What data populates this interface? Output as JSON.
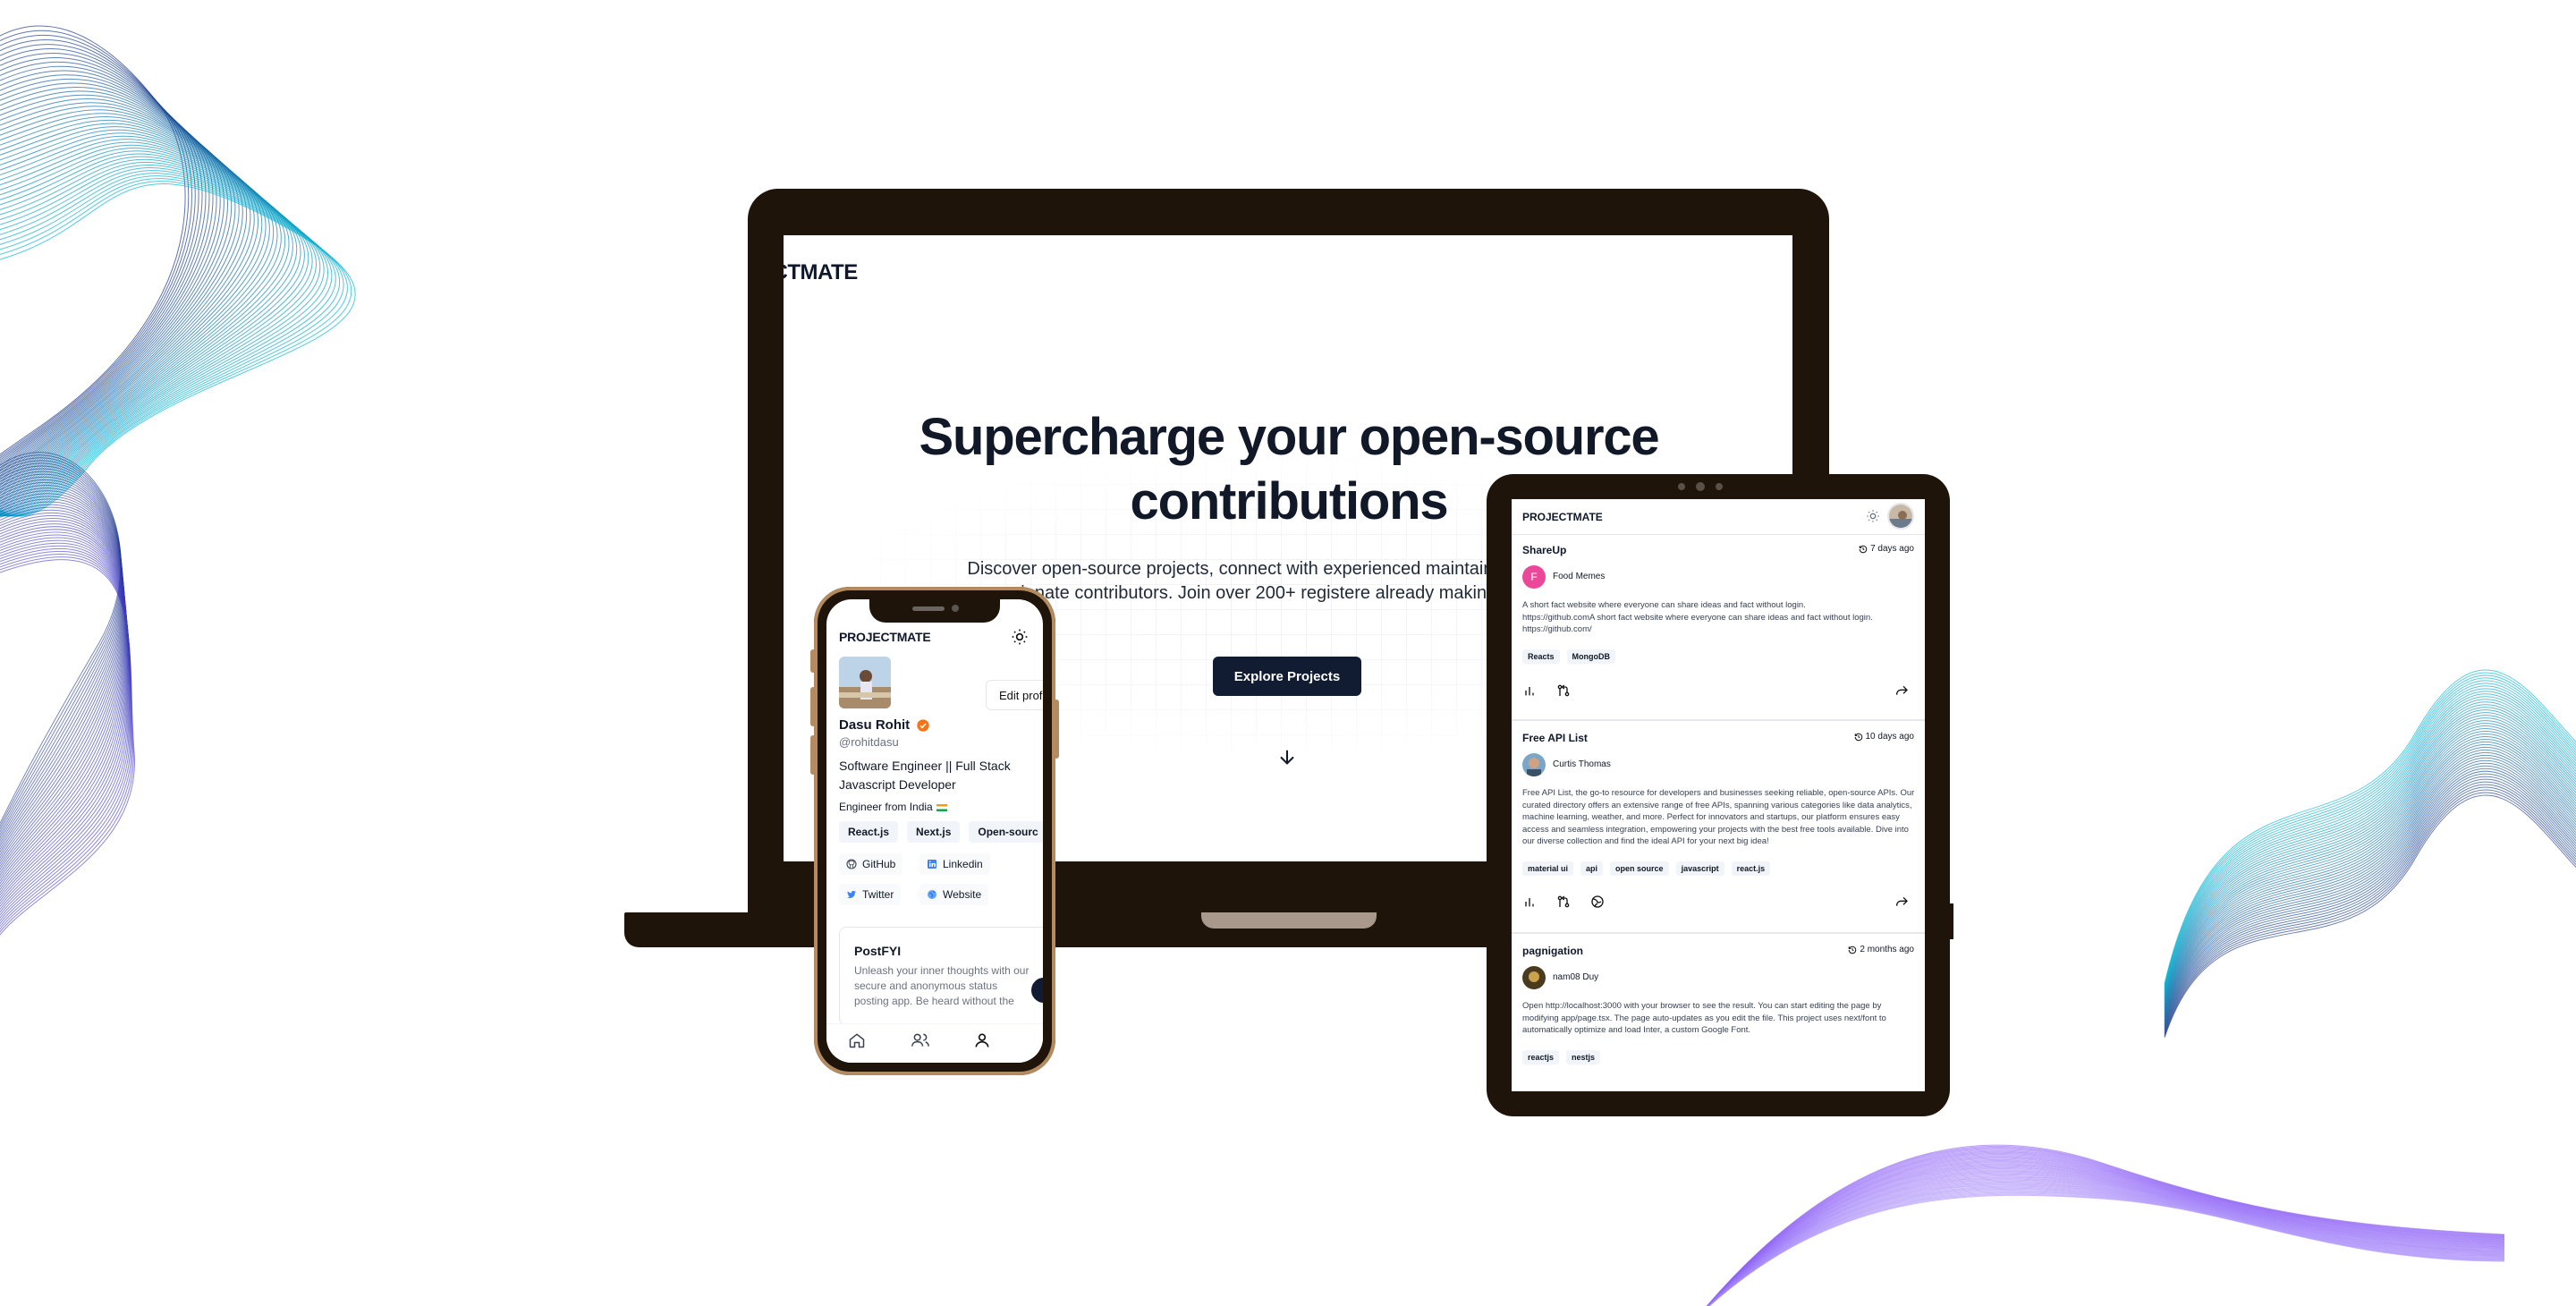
{
  "laptop": {
    "brand": "ECTMATE",
    "hero_title": "Supercharge your open-source contributions",
    "hero_subtitle": "Discover open-source projects, connect with experienced maintainers, and collaborate with a community of passionate contributors. Join over 200+ registered users already making a difference",
    "hero_subtitle_visible": "Discover open-source projects, connect with experienced maintainers mmunity of passionate contributors. Join over 200+ registere already making a difference",
    "cta_label": "Explore Projects",
    "scroll_icon": "arrow-down-icon"
  },
  "phone": {
    "brand": "PROJECTMATE",
    "theme_icon": "sun-icon",
    "edit_label": "Edit prof",
    "name": "Dasu Rohit",
    "handle": "@rohitdasu",
    "bio": "Software Engineer || Full Stack Javascript Developer",
    "location": "Engineer from India",
    "skills": [
      "React.js",
      "Next.js",
      "Open-sourc"
    ],
    "links": [
      {
        "label": "GitHub",
        "icon": "github-icon"
      },
      {
        "label": "Linkedin",
        "icon": "linkedin-icon"
      },
      {
        "label": "Twitter",
        "icon": "twitter-icon"
      },
      {
        "label": "Website",
        "icon": "globe-icon"
      }
    ],
    "card": {
      "title": "PostFYI",
      "description": "Unleash your inner thoughts with our secure and anonymous status posting app. Be heard without the"
    },
    "nav": [
      "home-icon",
      "users-icon",
      "user-icon"
    ]
  },
  "tablet": {
    "brand": "PROJECTMATE",
    "theme_icon": "sun-icon",
    "posts": [
      {
        "title": "ShareUp",
        "time": "7 days ago",
        "author": "Food Memes",
        "author_initial": "F",
        "description": "A short fact website where everyone can share ideas and fact without login.\nhttps://github.comA short fact website where everyone can share ideas and fact without login.\nhttps://github.com/",
        "tags": [
          "Reacts",
          "MongoDB"
        ]
      },
      {
        "title": "Free API List",
        "time": "10 days ago",
        "author": "Curtis Thomas",
        "author_initial": "",
        "description": "Free API List, the go-to resource for developers and businesses seeking reliable, open-source APIs. Our curated directory offers an extensive range of free APIs, spanning various categories like data analytics, machine learning, weather, and more. Perfect for innovators and startups, our platform ensures easy access and seamless integration, empowering your projects with the best free tools available. Dive into our diverse collection and find the ideal API for your next big idea!",
        "tags": [
          "material ui",
          "api",
          "open source",
          "javascript",
          "react.js"
        ]
      },
      {
        "title": "pagnigation",
        "time": "2 months ago",
        "author": "nam08 Duy",
        "author_initial": "",
        "description": "Open http://localhost:3000 with your browser to see the result. You can start editing the page by modifying app/page.tsx. The page auto-updates as you edit the file. This project uses next/font to automatically optimize and load Inter, a custom Google Font.",
        "tags": [
          "reactjs",
          "nestjs"
        ]
      }
    ]
  },
  "colors": {
    "device_frame": "#1e140a",
    "device_trim": "#b38b5e",
    "cta": "#111c33",
    "verified_badge": "#f97316",
    "food_memes_avatar": "#ec4899",
    "wave_left": "#1e3a8a",
    "wave_cyan": "#06b6d4",
    "wave_violet": "#8b5cf6"
  }
}
